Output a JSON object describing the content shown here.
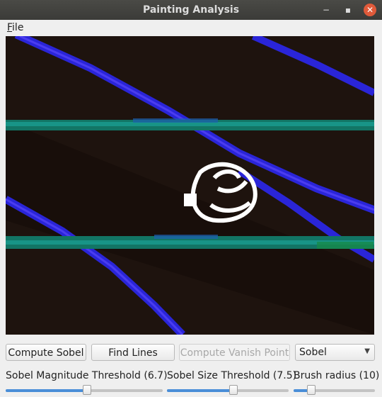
{
  "window": {
    "title": "Painting Analysis",
    "controls": {
      "minimize": "−",
      "maximize": "▪",
      "close": "✕"
    }
  },
  "menu": {
    "file_first": "F",
    "file_rest": "ile"
  },
  "buttons": {
    "compute_sobel": "Compute Sobel",
    "find_lines": "Find Lines",
    "compute_vanish_point": "Compute Vanish Point",
    "compute_vanish_point_enabled": false
  },
  "mode_select": {
    "value": "Sobel"
  },
  "sliders": [
    {
      "label": "Sobel Magnitude Threshold (6.7)",
      "fraction": 0.52
    },
    {
      "label": "Sobel Size Threshold (7.5)",
      "fraction": 0.55
    },
    {
      "label": "Brush radius (10)",
      "fraction": 0.18
    }
  ],
  "colors": {
    "background": "#1e130e",
    "blue_edge": "#2a25d8",
    "teal_edge": "#159a8a",
    "slider_fill": "#4a8ed8"
  }
}
